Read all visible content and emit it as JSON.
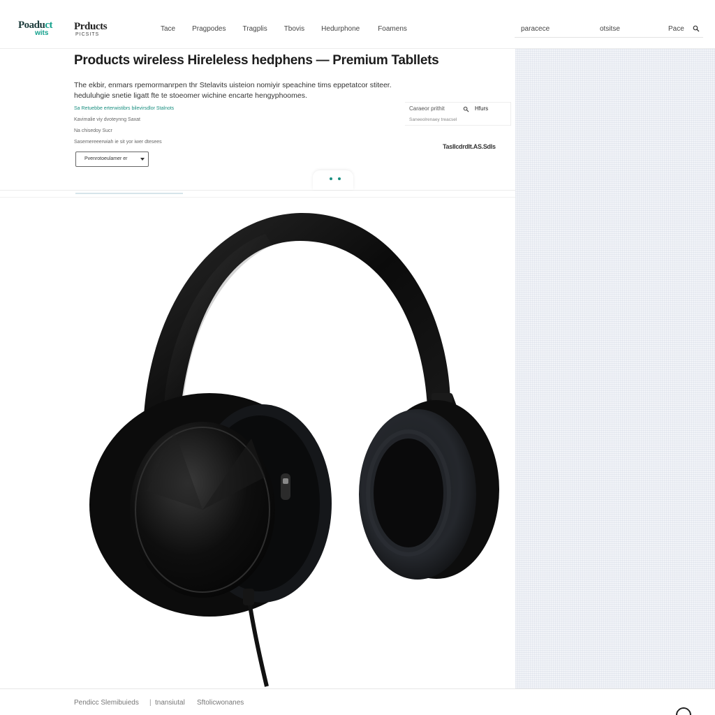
{
  "header": {
    "logo": {
      "part1": "Poadu",
      "part2": "ct",
      "part3": "wits"
    },
    "brand": {
      "name": "Prducts",
      "tagline": "PICSITS"
    },
    "nav": [
      "Tace",
      "Pragpodes",
      "Tragplis",
      "Tbovis",
      "Hedurphone",
      "Foamens"
    ],
    "utility": {
      "link1": "paracece",
      "link2": "otsitse",
      "page_label": "Pace"
    }
  },
  "product": {
    "title": "Products wireless Hireleless hedphens — Premium Tabllets",
    "description": "The ekbir, enmars rpemormanrpen thr Stelavits uisteion nomiyir speachine tims eppetatcor stiteer. heduluhgie snetie ligatt fte te stoeomer wichine encarte hengyphoomes.",
    "meta": [
      "Sa Retuebbe erterwistibrs bilevirsdlor Stalnots",
      "Kavimalie viy dvoteynng Saxat",
      "Na chisedoy Sucr",
      "Sasemereeerwiah ie sit yor iwer dtesees"
    ],
    "variant": "Pvenrotoeulamer er",
    "stock": {
      "label": "Caraeor prithit",
      "value": "Hfurs",
      "note": "Saneeolrenaey treacsel"
    },
    "price": "Tasllcdrdlt.AS.Sdls"
  },
  "footer": {
    "items": [
      "Pendicc Slemibuieds",
      "tnansiutal",
      "Sftolicwonanes"
    ]
  },
  "colors": {
    "accent": "#12a08c",
    "sidebar_bg": "#f2f4f8",
    "product": "#0d0d0d"
  },
  "icons": [
    "search-icon",
    "chevron-down-icon",
    "search-icon-small"
  ]
}
